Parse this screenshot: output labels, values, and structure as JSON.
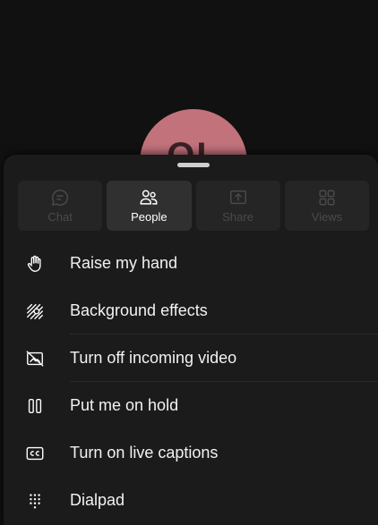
{
  "avatar": {
    "initials": "OL",
    "color": "#c2727b"
  },
  "tabs": [
    {
      "label": "Chat",
      "icon": "chat-icon",
      "active": false
    },
    {
      "label": "People",
      "icon": "people-icon",
      "active": true
    },
    {
      "label": "Share",
      "icon": "share-icon",
      "active": false
    },
    {
      "label": "Views",
      "icon": "views-grid-icon",
      "active": false
    }
  ],
  "menu": [
    {
      "label": "Raise my hand",
      "icon": "raise-hand-icon"
    },
    {
      "label": "Background effects",
      "icon": "background-effects-icon"
    },
    {
      "label": "Turn off incoming video",
      "icon": "video-off-icon"
    },
    {
      "label": "Put me on hold",
      "icon": "pause-icon"
    },
    {
      "label": "Turn on live captions",
      "icon": "captions-icon"
    },
    {
      "label": "Dialpad",
      "icon": "dialpad-icon"
    }
  ],
  "colors": {
    "sheet_background": "#1b1b1b",
    "tab_active_background": "#303030",
    "tab_disabled_text": "#4a4a4a"
  }
}
